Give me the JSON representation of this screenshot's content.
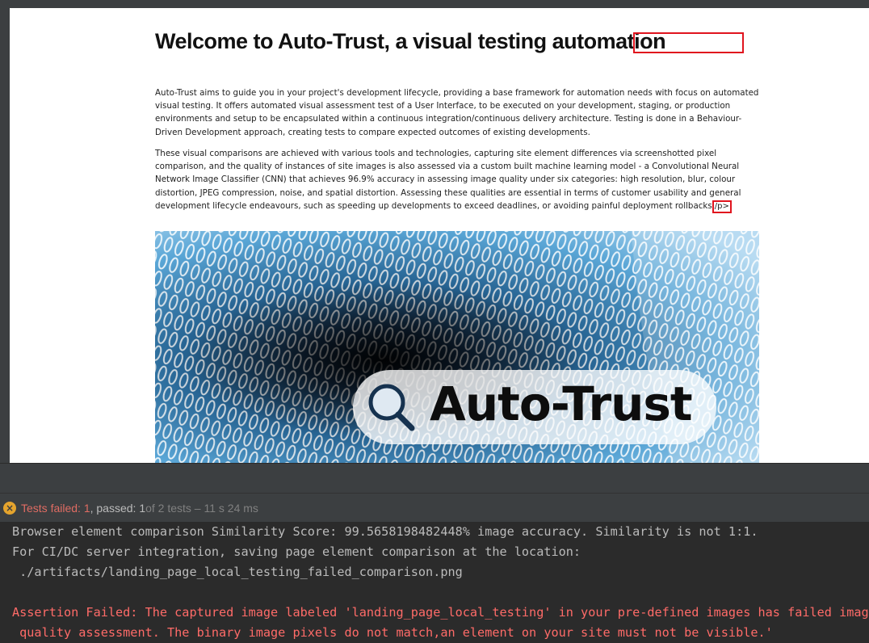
{
  "page": {
    "title": "Welcome to Auto-Trust, a visual testing automation",
    "paragraph1": "Auto-Trust aims to guide you in your project's development lifecycle, providing a base framework for automation needs with focus on automated visual testing. It offers automated visual assessment test of a User Interface, to be executed on your development, staging, or production environments and setup to be encapsulated within a continuous integration/continuous delivery architecture. Testing is done in a Behaviour-Driven Development approach, creating tests to compare expected outcomes of existing developments.",
    "paragraph2": "These visual comparisons are achieved with various tools and technologies, capturing site element differences via screenshotted pixel comparison, and the quality of instances of site images is also assessed via a custom built machine learning model - a Convolutional Neural Network Image Classifier (CNN) that achieves 96.9% accuracy in assessing image quality under six categories: high resolution, blur, colour distortion, JPEG compression, noise, and spatial distortion. Assessing these qualities are essential in terms of customer usability and general development lifecycle endeavours, such as speeding up developments to exceed deadlines, or avoiding painful deployment rollbacks",
    "paragraph2_diff_fragment": "/p>",
    "hero_logo_text": "Auto-Trust",
    "hero_icon": "magnifier-icon",
    "diff_highlight_color": "#e0141e"
  },
  "test_status": {
    "icon": "fail-icon",
    "failed_text": "Tests failed: 1",
    "passed_text": ", passed: 1",
    "of_text": " of 2 tests – 11 s 24 ms"
  },
  "console": {
    "lines": [
      "Browser element comparison Similarity Score: 99.5658198482448% image accuracy. Similarity is not 1:1.",
      "For CI/DC server integration, saving page element comparison at the location:",
      " ./artifacts/landing_page_local_testing_failed_comparison.png",
      "",
      "Assertion Failed: The captured image labeled 'landing_page_local_testing' in your pre-defined images has failed image",
      " quality assessment. The binary image pixels do not match,an element on your site must not be visible.'"
    ]
  }
}
